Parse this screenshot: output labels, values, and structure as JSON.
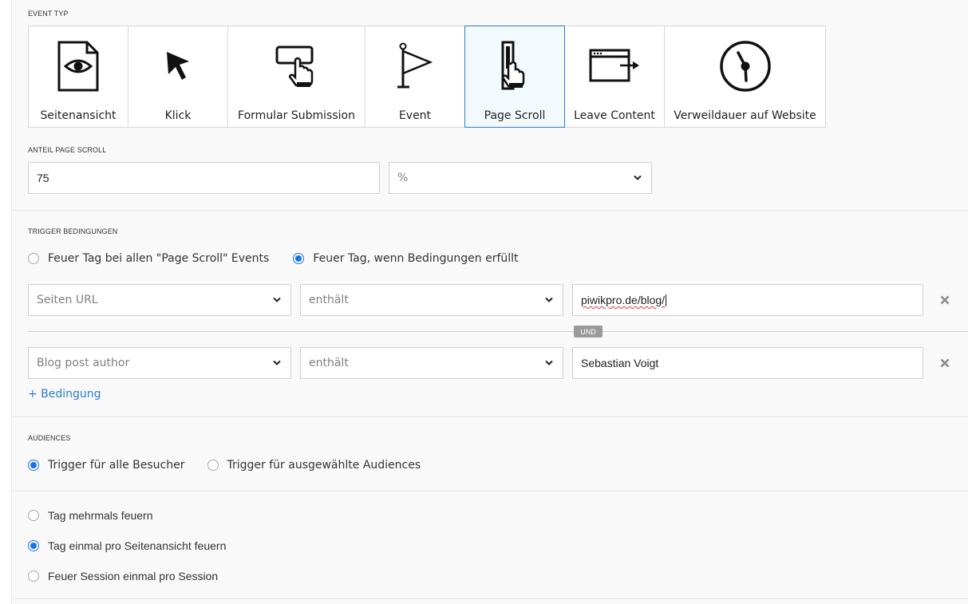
{
  "event_type": {
    "label": "EVENT TYP",
    "tiles": [
      {
        "label": "Seitenansicht",
        "icon": "page-view-icon",
        "selected": false
      },
      {
        "label": "Klick",
        "icon": "cursor-click-icon",
        "selected": false
      },
      {
        "label": "Formular Submission",
        "icon": "form-submit-icon",
        "selected": false
      },
      {
        "label": "Event",
        "icon": "flag-icon",
        "selected": false
      },
      {
        "label": "Page Scroll",
        "icon": "page-scroll-icon",
        "selected": true
      },
      {
        "label": "Leave Content",
        "icon": "leave-window-icon",
        "selected": false
      },
      {
        "label": "Verweildauer auf Website",
        "icon": "clock-icon",
        "selected": false
      }
    ]
  },
  "scroll_share": {
    "label": "ANTEIL PAGE SCROLL",
    "value": "75",
    "unit": "%"
  },
  "trigger": {
    "label": "TRIGGER BEDINGUNGEN",
    "options": [
      {
        "label": "Feuer Tag bei allen \"Page Scroll\" Events",
        "selected": false
      },
      {
        "label": "Feuer Tag, wenn Bedingungen erfüllt",
        "selected": true
      }
    ],
    "conditions": [
      {
        "variable": "Seiten URL",
        "operator": "enthält",
        "value": "piwikpro.de/blog/"
      },
      {
        "variable": "Blog post author",
        "operator": "enthält",
        "value": "Sebastian Voigt"
      }
    ],
    "joiner": "UND",
    "add_label": "+ Bedingung"
  },
  "audiences": {
    "label": "AUDIENCES",
    "options": [
      {
        "label": "Trigger für alle Besucher",
        "selected": true
      },
      {
        "label": "Trigger für ausgewählte Audiences",
        "selected": false
      }
    ]
  },
  "frequency": {
    "options": [
      {
        "label": "Tag mehrmals feuern",
        "selected": false
      },
      {
        "label": "Tag einmal pro Seitenansicht feuern",
        "selected": true
      },
      {
        "label": "Feuer Session einmal pro Session",
        "selected": false
      }
    ]
  },
  "colors": {
    "accent": "#1a73e8",
    "link": "#2e7bd1",
    "selected_tile_bg": "#f2fafd"
  }
}
